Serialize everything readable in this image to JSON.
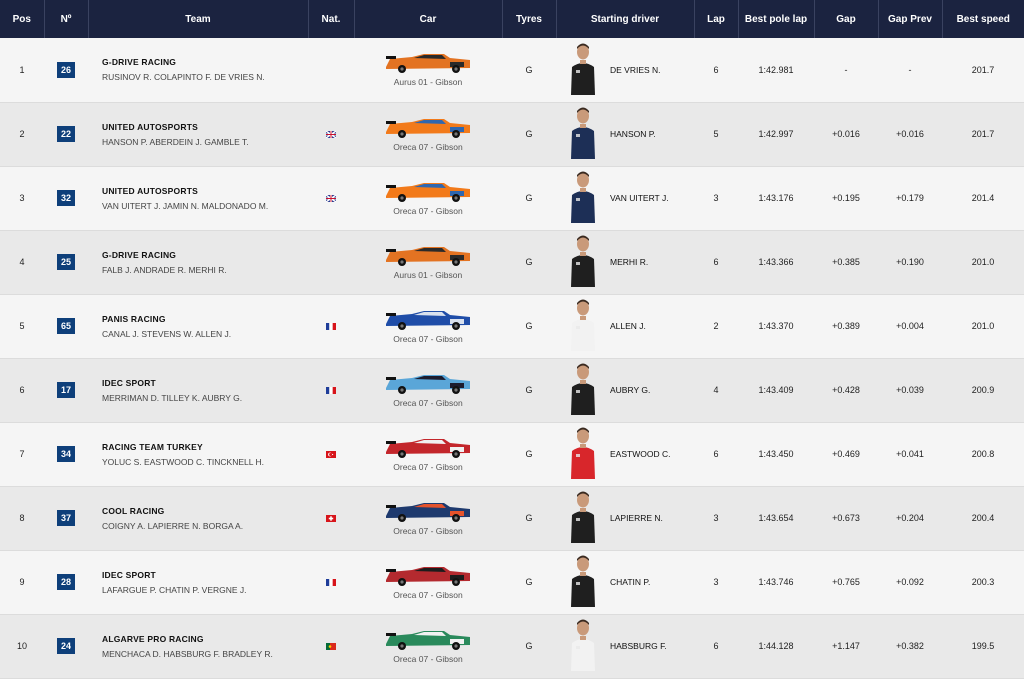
{
  "headers": [
    "Pos",
    "Nº",
    "Team",
    "Nat.",
    "Car",
    "Tyres",
    "Starting driver",
    "Lap",
    "Best pole lap",
    "Gap",
    "Gap Prev",
    "Best speed"
  ],
  "colors": {
    "header_bg": "#1b2340",
    "number_badge": "#0e3f7a"
  },
  "rows": [
    {
      "pos": "1",
      "num": "26",
      "team": "G-DRIVE RACING",
      "drivers": "RUSINOV R. COLAPINTO F. DE VRIES N.",
      "nat": "",
      "car": "Aurus 01 - Gibson",
      "livery": "gdrive",
      "tyres": "G",
      "driver": "DE VRIES N.",
      "suit": "black",
      "lap": "6",
      "best": "1:42.981",
      "gap": "-",
      "gap_prev": "-",
      "speed": "201.7"
    },
    {
      "pos": "2",
      "num": "22",
      "team": "UNITED AUTOSPORTS",
      "drivers": "HANSON P. ABERDEIN J. GAMBLE T.",
      "nat": "gb",
      "car": "Oreca 07 - Gibson",
      "livery": "united",
      "tyres": "G",
      "driver": "HANSON P.",
      "suit": "navy",
      "lap": "5",
      "best": "1:42.997",
      "gap": "+0.016",
      "gap_prev": "+0.016",
      "speed": "201.7"
    },
    {
      "pos": "3",
      "num": "32",
      "team": "UNITED AUTOSPORTS",
      "drivers": "VAN UITERT J. JAMIN N. MALDONADO M.",
      "nat": "gb",
      "car": "Oreca 07 - Gibson",
      "livery": "united",
      "tyres": "G",
      "driver": "VAN UITERT J.",
      "suit": "navy",
      "lap": "3",
      "best": "1:43.176",
      "gap": "+0.195",
      "gap_prev": "+0.179",
      "speed": "201.4"
    },
    {
      "pos": "4",
      "num": "25",
      "team": "G-DRIVE RACING",
      "drivers": "FALB J. ANDRADE R. MERHI R.",
      "nat": "",
      "car": "Aurus 01 - Gibson",
      "livery": "gdrive",
      "tyres": "G",
      "driver": "MERHI R.",
      "suit": "black",
      "lap": "6",
      "best": "1:43.366",
      "gap": "+0.385",
      "gap_prev": "+0.190",
      "speed": "201.0"
    },
    {
      "pos": "5",
      "num": "65",
      "team": "PANIS RACING",
      "drivers": "CANAL J. STEVENS W. ALLEN J.",
      "nat": "fr",
      "car": "Oreca 07 - Gibson",
      "livery": "panis",
      "tyres": "G",
      "driver": "ALLEN J.",
      "suit": "white",
      "lap": "2",
      "best": "1:43.370",
      "gap": "+0.389",
      "gap_prev": "+0.004",
      "speed": "201.0"
    },
    {
      "pos": "6",
      "num": "17",
      "team": "IDEC SPORT",
      "drivers": "MERRIMAN D. TILLEY K. AUBRY G.",
      "nat": "fr",
      "car": "Oreca 07 - Gibson",
      "livery": "idec17",
      "tyres": "G",
      "driver": "AUBRY G.",
      "suit": "black",
      "lap": "4",
      "best": "1:43.409",
      "gap": "+0.428",
      "gap_prev": "+0.039",
      "speed": "200.9"
    },
    {
      "pos": "7",
      "num": "34",
      "team": "RACING TEAM TURKEY",
      "drivers": "YOLUC S. EASTWOOD C. TINCKNELL H.",
      "nat": "tr",
      "car": "Oreca 07 - Gibson",
      "livery": "turkey",
      "tyres": "G",
      "driver": "EASTWOOD C.",
      "suit": "red",
      "lap": "6",
      "best": "1:43.450",
      "gap": "+0.469",
      "gap_prev": "+0.041",
      "speed": "200.8"
    },
    {
      "pos": "8",
      "num": "37",
      "team": "COOL RACING",
      "drivers": "COIGNY A. LAPIERRE N. BORGA A.",
      "nat": "ch",
      "car": "Oreca 07 - Gibson",
      "livery": "cool",
      "tyres": "G",
      "driver": "LAPIERRE N.",
      "suit": "black",
      "lap": "3",
      "best": "1:43.654",
      "gap": "+0.673",
      "gap_prev": "+0.204",
      "speed": "200.4"
    },
    {
      "pos": "9",
      "num": "28",
      "team": "IDEC SPORT",
      "drivers": "LAFARGUE P. CHATIN P. VERGNE J.",
      "nat": "fr",
      "car": "Oreca 07 - Gibson",
      "livery": "idec28",
      "tyres": "G",
      "driver": "CHATIN P.",
      "suit": "black",
      "lap": "3",
      "best": "1:43.746",
      "gap": "+0.765",
      "gap_prev": "+0.092",
      "speed": "200.3"
    },
    {
      "pos": "10",
      "num": "24",
      "team": "ALGARVE PRO RACING",
      "drivers": "MENCHACA D. HABSBURG F. BRADLEY R.",
      "nat": "pt",
      "car": "Oreca 07 - Gibson",
      "livery": "algarve",
      "tyres": "G",
      "driver": "HABSBURG F.",
      "suit": "white",
      "lap": "6",
      "best": "1:44.128",
      "gap": "+1.147",
      "gap_prev": "+0.382",
      "speed": "199.5"
    }
  ]
}
